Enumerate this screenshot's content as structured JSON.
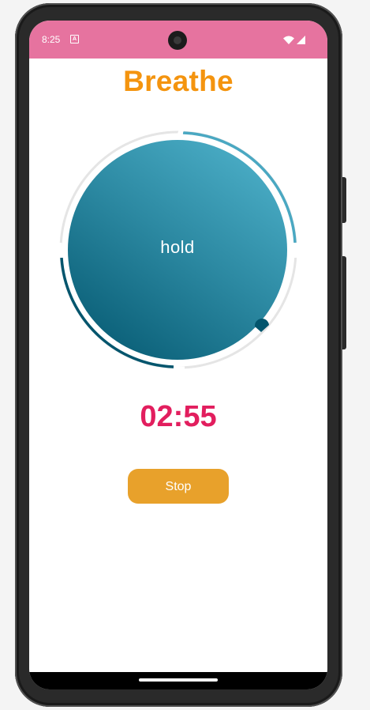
{
  "status_bar": {
    "time": "8:25",
    "notification_badge": "A",
    "background_color": "#e6739f",
    "icons": [
      "wifi-icon",
      "signal-icon"
    ]
  },
  "app": {
    "title": "Breathe",
    "title_color": "#f4940f",
    "phase": "hold",
    "timer": "02:55",
    "timer_color": "#e21e5e",
    "stop_label": "Stop",
    "button_color": "#e8a12b",
    "circle_gradient": [
      "#02556d",
      "#52b6cf"
    ]
  }
}
